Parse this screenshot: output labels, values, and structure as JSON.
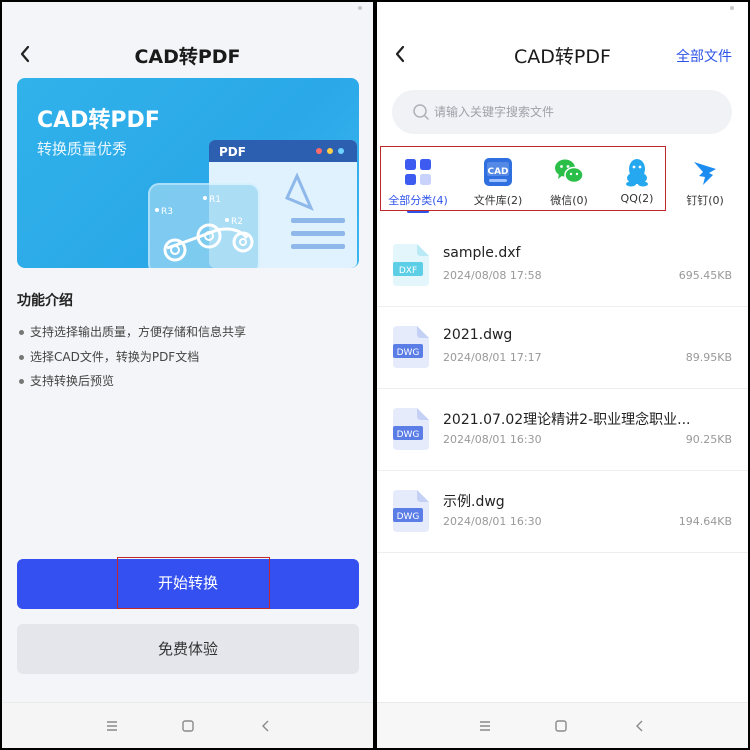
{
  "left": {
    "header": {
      "title": "CAD转PDF"
    },
    "banner": {
      "title": "CAD转PDF",
      "subtitle": "转换质量优秀",
      "doc_label": "PDF",
      "labels": [
        "R3",
        "R1",
        "R2"
      ]
    },
    "intro": {
      "title": "功能介绍",
      "items": [
        "支持选择输出质量，方便存储和信息共享",
        "选择CAD文件，转换为PDF文档",
        "支持转换后预览"
      ]
    },
    "primary_button": "开始转换",
    "secondary_button": "免费体验"
  },
  "right": {
    "header": {
      "title": "CAD转PDF",
      "link": "全部文件"
    },
    "search": {
      "placeholder": "请输入关键字搜索文件"
    },
    "categories": [
      {
        "label": "全部分类(4)",
        "icon": "grid-icon",
        "active": true
      },
      {
        "label": "文件库(2)",
        "icon": "cad-library-icon",
        "active": false
      },
      {
        "label": "微信(0)",
        "icon": "wechat-icon",
        "active": false
      },
      {
        "label": "QQ(2)",
        "icon": "qq-icon",
        "active": false
      },
      {
        "label": "钉钉(0)",
        "icon": "dingtalk-icon",
        "active": false
      }
    ],
    "files": [
      {
        "name": "sample.dxf",
        "type": "DXF",
        "date": "2024/08/08  17:58",
        "size": "695.45KB"
      },
      {
        "name": "2021.dwg",
        "type": "DWG",
        "date": "2024/08/01  17:17",
        "size": "89.95KB"
      },
      {
        "name": "2021.07.02理论精讲2-职业理念职业...",
        "type": "DWG",
        "date": "2024/08/01  16:30",
        "size": "90.25KB"
      },
      {
        "name": "示例.dwg",
        "type": "DWG",
        "date": "2024/08/01  16:30",
        "size": "194.64KB"
      }
    ]
  },
  "colors": {
    "accent": "#3550f0",
    "banner": "#31b2ea",
    "highlight": "#c0282a",
    "dxf": "#5ccfe6",
    "dwg": "#5b7de6"
  }
}
